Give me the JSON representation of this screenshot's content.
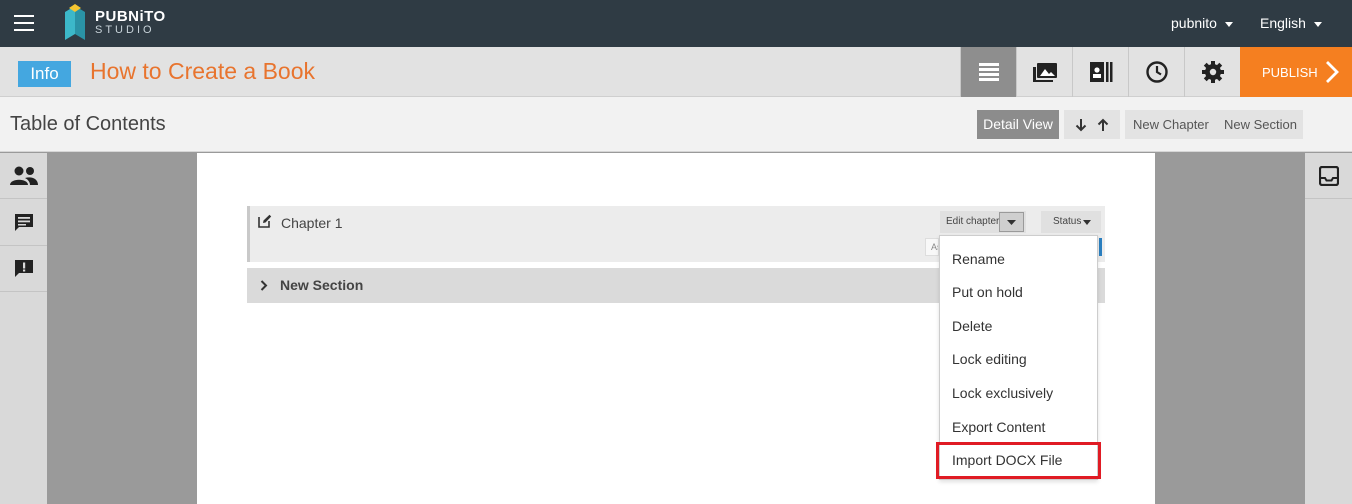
{
  "topbar": {
    "logo_line1": "PUBNiTO",
    "logo_line2": "STUDIO",
    "user_menu": "pubnito",
    "language_menu": "English"
  },
  "titlebar": {
    "info_label": "Info",
    "book_title": "How to Create a Book",
    "publish_label": "PUBLISH",
    "icons": [
      "list-icon",
      "images-icon",
      "library-icon",
      "history-icon",
      "settings-icon"
    ]
  },
  "toc": {
    "title": "Table of Contents",
    "detail_view": "Detail View",
    "new_chapter": "New Chapter",
    "new_section": "New Section"
  },
  "leftpanel": {
    "icons": [
      "users-icon",
      "comment-icon",
      "feedback-icon"
    ]
  },
  "rightpanel": {
    "icons": [
      "inbox-icon"
    ]
  },
  "content": {
    "chapter_label": "Chapter 1",
    "edit_chapter": "Edit chapter",
    "status": "Status",
    "assign_stub": "As",
    "section_label": "New Section"
  },
  "dropdown": {
    "items": [
      "Rename",
      "Put on hold",
      "Delete",
      "Lock editing",
      "Lock exclusively",
      "Export Content",
      "Import DOCX File"
    ],
    "highlighted_item": "Import DOCX File"
  },
  "colors": {
    "topbar": "#2f3b44",
    "info_badge": "#44a7e0",
    "book_title": "#e8742e",
    "publish": "#f57f20",
    "highlight": "#e01b24"
  }
}
